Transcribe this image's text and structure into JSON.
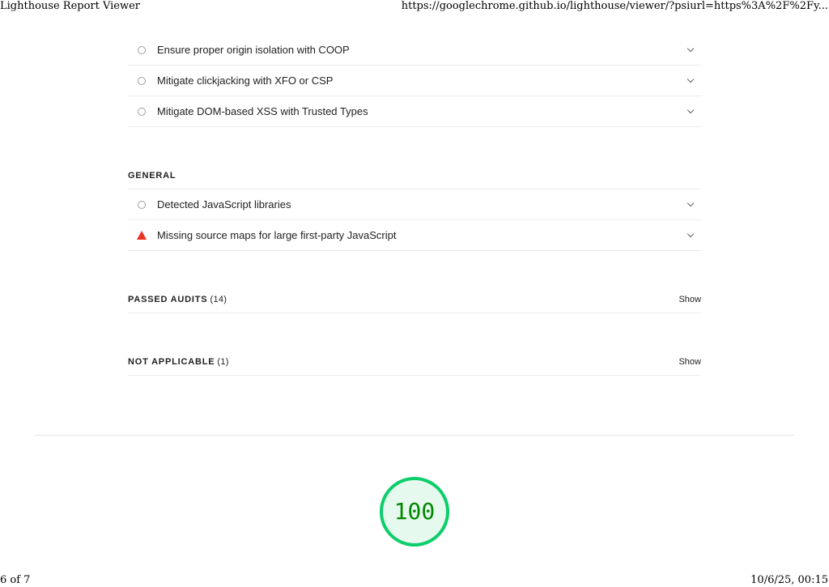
{
  "print_header": {
    "title": "Lighthouse Report Viewer",
    "url": "https://googlechrome.github.io/lighthouse/viewer/?psiurl=https%3A%2F%2Fy..."
  },
  "audits": [
    {
      "title": "Ensure proper origin isolation with COOP",
      "status": "informative",
      "icon": "circle-icon"
    },
    {
      "title": "Mitigate clickjacking with XFO or CSP",
      "status": "informative",
      "icon": "circle-icon"
    },
    {
      "title": "Mitigate DOM-based XSS with Trusted Types",
      "status": "informative",
      "icon": "circle-icon"
    }
  ],
  "general": {
    "heading": "GENERAL",
    "audits": [
      {
        "title": "Detected JavaScript libraries",
        "status": "informative",
        "icon": "circle-icon"
      },
      {
        "title": "Missing source maps for large first-party JavaScript",
        "status": "fail",
        "icon": "triangle-warning-icon"
      }
    ]
  },
  "passed_audits": {
    "label": "PASSED AUDITS",
    "count": "(14)",
    "action": "Show"
  },
  "not_applicable": {
    "label": "NOT APPLICABLE",
    "count": "(1)",
    "action": "Show"
  },
  "score_gauge": {
    "score": "100",
    "fraction": 1.0,
    "colors": {
      "ring": "#0cce6b",
      "fill": "#e6f9ee",
      "text": "#008800"
    }
  },
  "print_footer": {
    "page": "6 of 7",
    "datetime": "10/6/25, 00:15"
  },
  "colors": {
    "fail": "#eb3223",
    "informative": "#9aa0a6",
    "divider": "#ebebeb"
  }
}
